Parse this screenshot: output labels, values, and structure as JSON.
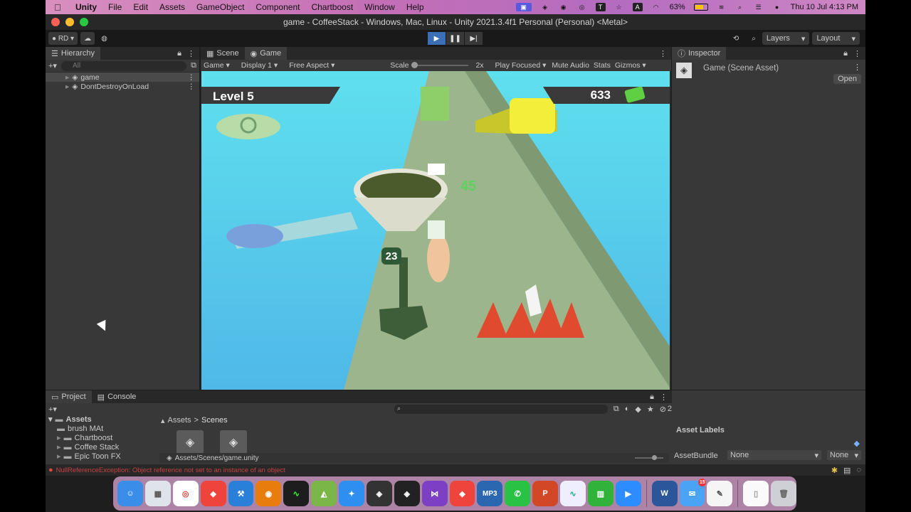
{
  "menubar": {
    "app": "Unity",
    "items": [
      "File",
      "Edit",
      "Assets",
      "GameObject",
      "Component",
      "Chartboost",
      "Window",
      "Help"
    ],
    "battery": "63%",
    "datetime": "Thu 10 Jul  4:13 PM"
  },
  "window": {
    "title": "game - CoffeeStack - Windows, Mac, Linux - Unity 2021.3.4f1 Personal (Personal) <Metal>"
  },
  "toolbar": {
    "account": "RD",
    "layers": "Layers",
    "layout": "Layout"
  },
  "hierarchy": {
    "tab": "Hierarchy",
    "search_placeholder": "All",
    "items": [
      {
        "label": "game"
      },
      {
        "label": "DontDestroyOnLoad"
      }
    ]
  },
  "game_panel": {
    "tabs": [
      "Scene",
      "Game"
    ],
    "view_mode": "Game",
    "display": "Display 1",
    "aspect": "Free Aspect",
    "scale_label": "Scale",
    "scale_value": "2x",
    "play_focused": "Play Focused",
    "mute": "Mute Audio",
    "stats": "Stats",
    "gizmos": "Gizmos"
  },
  "game_hud": {
    "level": "Level 5",
    "coins": "633",
    "cup_count": "23",
    "floating_number": "45"
  },
  "inspector": {
    "tab": "Inspector",
    "asset_name": "Game (Scene Asset)",
    "open_button": "Open"
  },
  "project": {
    "tabs": [
      "Project",
      "Console"
    ],
    "tree_root": "Assets",
    "folders": [
      "brush MAt",
      "Chartboost",
      "Coffee Stack",
      "Epic Toon FX"
    ],
    "breadcrumb": [
      "Assets",
      "Scenes"
    ],
    "selected_path": "Assets/Scenes/game.unity",
    "hidden_count": "2"
  },
  "asset_labels": {
    "title": "Asset Labels",
    "bundle_label": "AssetBundle",
    "bundle_value": "None",
    "variant_value": "None"
  },
  "status": {
    "error": "NullReferenceException: Object reference not set to an instance of an object"
  },
  "dock": {
    "apps": [
      "Finder",
      "Launchpad",
      "Chrome",
      "AnyDesk",
      "Xcode",
      "Blender",
      "Activity Monitor",
      "Android Studio",
      "Safari",
      "Unity Hub",
      "Unity",
      "Visual Studio",
      "AnyDesk 2",
      "MP3",
      "WhatsApp",
      "PowerPoint",
      "Monitor",
      "Numbers",
      "Zoom",
      "Word",
      "Mail",
      "TextEdit",
      "Document",
      "Trash"
    ],
    "mail_badge": "15"
  }
}
